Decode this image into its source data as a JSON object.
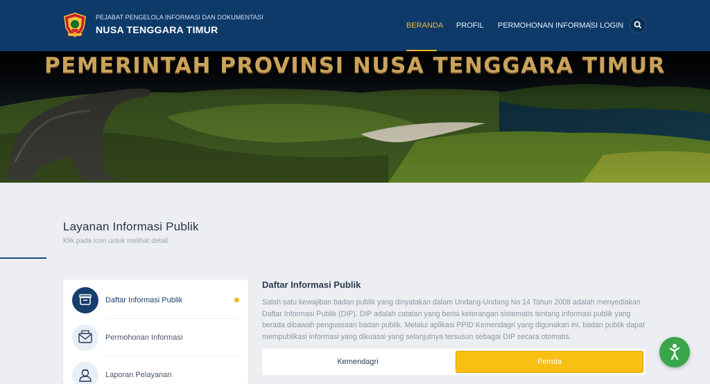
{
  "header": {
    "brand_small": "PEJABAT PENGELOLA INFORMASI DAN DOKUMENTASI",
    "brand_big": "NUSA TENGGARA TIMUR",
    "nav": [
      {
        "label": "BERANDA",
        "active": true
      },
      {
        "label": "PROFIL",
        "active": false
      },
      {
        "label": "PERMOHONAN INFORMASI",
        "active": false
      },
      {
        "label": "LOGIN",
        "active": false
      }
    ],
    "search_icon": "search-icon",
    "accent_color": "#f2b62a",
    "bar_color": "#0e3a6a"
  },
  "banner": {
    "title": "PEMERINTAH PROVINSI NUSA TENGGARA TIMUR"
  },
  "section": {
    "title": "Layanan Informasi Publik",
    "subtitle": "Klik pada icon untuk melihat detail"
  },
  "menu": {
    "items": [
      {
        "label": "Daftar Informasi Publik",
        "icon": "archive-icon",
        "active": true
      },
      {
        "label": "Permohonan Informasi",
        "icon": "envelope-icon",
        "active": false
      },
      {
        "label": "Laporan Pelayanan",
        "icon": "user-report-icon",
        "active": false
      }
    ]
  },
  "detail": {
    "title": "Daftar Informasi Publik",
    "text": "Salah satu kewajiban badan publik yang dinyatakan dalam Undang-Undang No 14 Tahun 2008 adalah menyediakan Daftar Informasi Publik (DIP). DIP adalah catatan yang berisi keterangan sistematis tentang informasi publik yang berada dibawah penguasaan badan publik. Melalui aplikasi PPID Kemendagri yang digunakan ini, badan publik dapat mempublikasi informasi yang dikuasai yang selanjutnya tersusun sebagai DIP secara otomatis.",
    "tabs": [
      {
        "label": "Kemendagri",
        "active": false
      },
      {
        "label": "Pemda",
        "active": true
      }
    ]
  },
  "fab": {
    "icon": "accessibility-icon",
    "color": "#3aa64a"
  }
}
